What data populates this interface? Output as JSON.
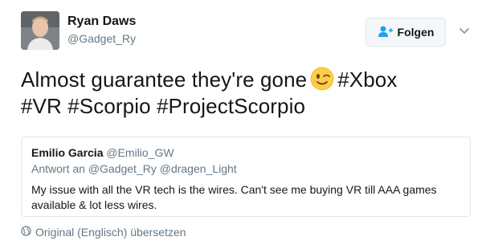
{
  "author": {
    "name": "Ryan Daws",
    "handle": "@Gadget_Ry"
  },
  "follow_button": {
    "label": "Folgen",
    "icon": "follow-user-icon"
  },
  "menu_icon": "chevron-down-icon",
  "tweet": {
    "text_before_emoji": "Almost guarantee they're gone",
    "emoji": "winking-face-emoji",
    "hashtags": [
      "#Xbox",
      "#VR",
      "#Scorpio",
      "#ProjectScorpio"
    ]
  },
  "quoted_tweet": {
    "name": "Emilio Garcia",
    "handle": "@Emilio_GW",
    "reply_to": "Antwort an @Gadget_Ry @dragen_Light",
    "text": "My issue with all the VR tech is the wires. Can't see me buying VR till AAA games available & lot less wires."
  },
  "translate": {
    "label": "Original (Englisch) übersetzen",
    "icon": "globe-icon"
  },
  "colors": {
    "primary_text": "#14171a",
    "secondary_text": "#657786",
    "link": "#1da1f2",
    "border": "#e1e8ed"
  }
}
